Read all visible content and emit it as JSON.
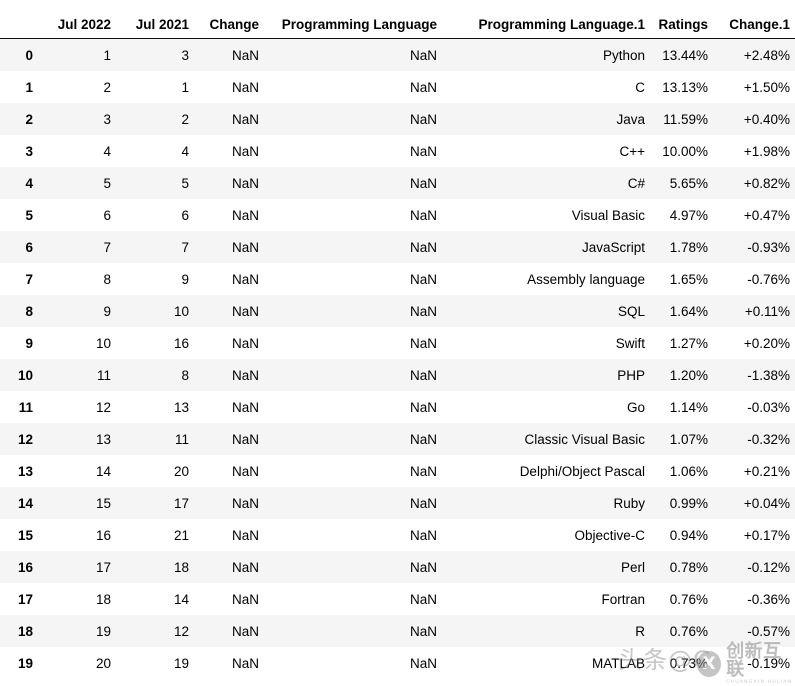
{
  "table": {
    "index_header": "",
    "columns": [
      "Jul 2022",
      "Jul 2021",
      "Change",
      "Programming Language",
      "Programming Language.1",
      "Ratings",
      "Change.1"
    ],
    "rows": [
      {
        "index": "0",
        "cells": [
          "1",
          "3",
          "NaN",
          "NaN",
          "Python",
          "13.44%",
          "+2.48%"
        ]
      },
      {
        "index": "1",
        "cells": [
          "2",
          "1",
          "NaN",
          "NaN",
          "C",
          "13.13%",
          "+1.50%"
        ]
      },
      {
        "index": "2",
        "cells": [
          "3",
          "2",
          "NaN",
          "NaN",
          "Java",
          "11.59%",
          "+0.40%"
        ]
      },
      {
        "index": "3",
        "cells": [
          "4",
          "4",
          "NaN",
          "NaN",
          "C++",
          "10.00%",
          "+1.98%"
        ]
      },
      {
        "index": "4",
        "cells": [
          "5",
          "5",
          "NaN",
          "NaN",
          "C#",
          "5.65%",
          "+0.82%"
        ]
      },
      {
        "index": "5",
        "cells": [
          "6",
          "6",
          "NaN",
          "NaN",
          "Visual Basic",
          "4.97%",
          "+0.47%"
        ]
      },
      {
        "index": "6",
        "cells": [
          "7",
          "7",
          "NaN",
          "NaN",
          "JavaScript",
          "1.78%",
          "-0.93%"
        ]
      },
      {
        "index": "7",
        "cells": [
          "8",
          "9",
          "NaN",
          "NaN",
          "Assembly language",
          "1.65%",
          "-0.76%"
        ]
      },
      {
        "index": "8",
        "cells": [
          "9",
          "10",
          "NaN",
          "NaN",
          "SQL",
          "1.64%",
          "+0.11%"
        ]
      },
      {
        "index": "9",
        "cells": [
          "10",
          "16",
          "NaN",
          "NaN",
          "Swift",
          "1.27%",
          "+0.20%"
        ]
      },
      {
        "index": "10",
        "cells": [
          "11",
          "8",
          "NaN",
          "NaN",
          "PHP",
          "1.20%",
          "-1.38%"
        ]
      },
      {
        "index": "11",
        "cells": [
          "12",
          "13",
          "NaN",
          "NaN",
          "Go",
          "1.14%",
          "-0.03%"
        ]
      },
      {
        "index": "12",
        "cells": [
          "13",
          "11",
          "NaN",
          "NaN",
          "Classic Visual Basic",
          "1.07%",
          "-0.32%"
        ]
      },
      {
        "index": "13",
        "cells": [
          "14",
          "20",
          "NaN",
          "NaN",
          "Delphi/Object Pascal",
          "1.06%",
          "+0.21%"
        ]
      },
      {
        "index": "14",
        "cells": [
          "15",
          "17",
          "NaN",
          "NaN",
          "Ruby",
          "0.99%",
          "+0.04%"
        ]
      },
      {
        "index": "15",
        "cells": [
          "16",
          "21",
          "NaN",
          "NaN",
          "Objective-C",
          "0.94%",
          "+0.17%"
        ]
      },
      {
        "index": "16",
        "cells": [
          "17",
          "18",
          "NaN",
          "NaN",
          "Perl",
          "0.78%",
          "-0.12%"
        ]
      },
      {
        "index": "17",
        "cells": [
          "18",
          "14",
          "NaN",
          "NaN",
          "Fortran",
          "0.76%",
          "-0.36%"
        ]
      },
      {
        "index": "18",
        "cells": [
          "19",
          "12",
          "NaN",
          "NaN",
          "R",
          "0.76%",
          "-0.57%"
        ]
      },
      {
        "index": "19",
        "cells": [
          "20",
          "19",
          "NaN",
          "NaN",
          "MATLAB",
          "0.73%",
          "-0.19%"
        ]
      }
    ]
  },
  "watermarks": {
    "toutiao": "头条@C",
    "brand_mark": "X",
    "brand_cn": "创新互联",
    "brand_sub": "CHUANGXIN HULIAN"
  },
  "colors": {
    "row_stripe": "#f5f5f5",
    "row_plain": "#ffffff",
    "text": "#000000",
    "header_rule": "#111111"
  }
}
